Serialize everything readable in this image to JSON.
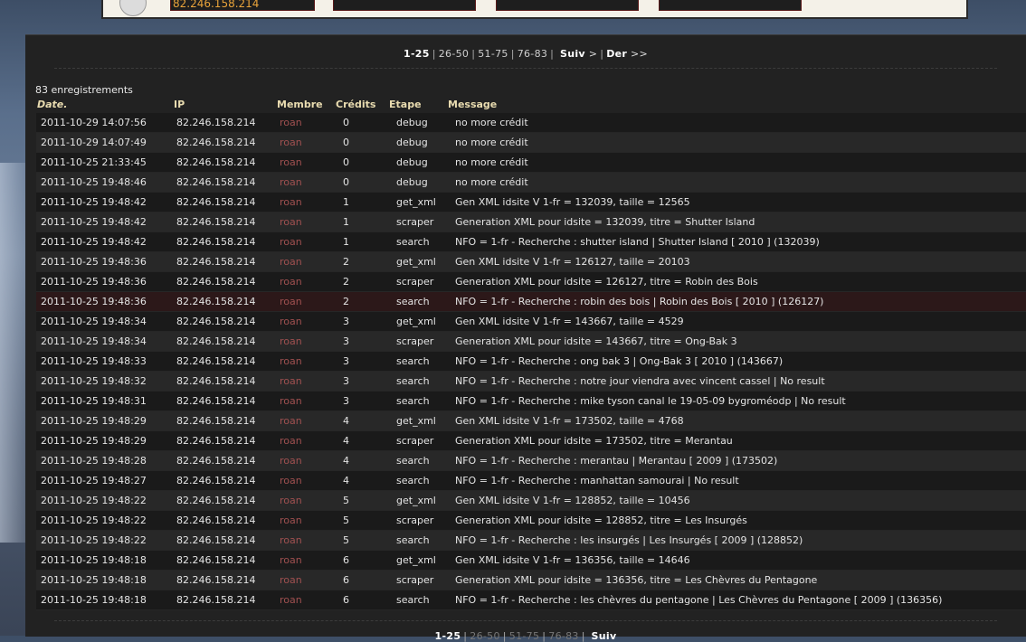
{
  "top_panel": {
    "ip_value": "82.246.158.214"
  },
  "pager": {
    "current": "1-25",
    "pages": [
      "26-50",
      "51-75",
      "76-83"
    ],
    "next_label": "Suiv",
    "next_arrow": ">",
    "last_label": "Der",
    "last_arrow": ">>"
  },
  "record_count": "83 enregistrements",
  "columns": {
    "date": "Date.",
    "ip": "IP",
    "member": "Membre",
    "credits": "Crédits",
    "step": "Etape",
    "message": "Message"
  },
  "rows": [
    {
      "date": "2011-10-29 14:07:56",
      "ip": "82.246.158.214",
      "member": "roan",
      "credits": "0",
      "step": "debug",
      "message": "no more crédit"
    },
    {
      "date": "2011-10-29 14:07:49",
      "ip": "82.246.158.214",
      "member": "roan",
      "credits": "0",
      "step": "debug",
      "message": "no more crédit"
    },
    {
      "date": "2011-10-25 21:33:45",
      "ip": "82.246.158.214",
      "member": "roan",
      "credits": "0",
      "step": "debug",
      "message": "no more crédit"
    },
    {
      "date": "2011-10-25 19:48:46",
      "ip": "82.246.158.214",
      "member": "roan",
      "credits": "0",
      "step": "debug",
      "message": "no more crédit"
    },
    {
      "date": "2011-10-25 19:48:42",
      "ip": "82.246.158.214",
      "member": "roan",
      "credits": "1",
      "step": "get_xml",
      "message": "Gen XML idsite V 1-fr = 132039, taille = 12565"
    },
    {
      "date": "2011-10-25 19:48:42",
      "ip": "82.246.158.214",
      "member": "roan",
      "credits": "1",
      "step": "scraper",
      "message": "Generation XML pour idsite = 132039, titre = Shutter Island"
    },
    {
      "date": "2011-10-25 19:48:42",
      "ip": "82.246.158.214",
      "member": "roan",
      "credits": "1",
      "step": "search",
      "message": "NFO = 1-fr - Recherche : shutter island | Shutter Island [ 2010 ] (132039)"
    },
    {
      "date": "2011-10-25 19:48:36",
      "ip": "82.246.158.214",
      "member": "roan",
      "credits": "2",
      "step": "get_xml",
      "message": "Gen XML idsite V 1-fr = 126127, taille = 20103"
    },
    {
      "date": "2011-10-25 19:48:36",
      "ip": "82.246.158.214",
      "member": "roan",
      "credits": "2",
      "step": "scraper",
      "message": "Generation XML pour idsite = 126127, titre = Robin des Bois"
    },
    {
      "date": "2011-10-25 19:48:36",
      "ip": "82.246.158.214",
      "member": "roan",
      "credits": "2",
      "step": "search",
      "message": "NFO = 1-fr - Recherche : robin des bois | Robin des Bois [ 2010 ] (126127)"
    },
    {
      "date": "2011-10-25 19:48:34",
      "ip": "82.246.158.214",
      "member": "roan",
      "credits": "3",
      "step": "get_xml",
      "message": "Gen XML idsite V 1-fr = 143667, taille = 4529"
    },
    {
      "date": "2011-10-25 19:48:34",
      "ip": "82.246.158.214",
      "member": "roan",
      "credits": "3",
      "step": "scraper",
      "message": "Generation XML pour idsite = 143667, titre = Ong-Bak 3"
    },
    {
      "date": "2011-10-25 19:48:33",
      "ip": "82.246.158.214",
      "member": "roan",
      "credits": "3",
      "step": "search",
      "message": "NFO = 1-fr - Recherche : ong bak 3 | Ong-Bak 3 [ 2010 ] (143667)"
    },
    {
      "date": "2011-10-25 19:48:32",
      "ip": "82.246.158.214",
      "member": "roan",
      "credits": "3",
      "step": "search",
      "message": "NFO = 1-fr - Recherche : notre jour viendra avec vincent cassel | No result"
    },
    {
      "date": "2011-10-25 19:48:31",
      "ip": "82.246.158.214",
      "member": "roan",
      "credits": "3",
      "step": "search",
      "message": "NFO = 1-fr - Recherche : mike tyson canal le 19-05-09 bygroméodp | No result"
    },
    {
      "date": "2011-10-25 19:48:29",
      "ip": "82.246.158.214",
      "member": "roan",
      "credits": "4",
      "step": "get_xml",
      "message": "Gen XML idsite V 1-fr = 173502, taille = 4768"
    },
    {
      "date": "2011-10-25 19:48:29",
      "ip": "82.246.158.214",
      "member": "roan",
      "credits": "4",
      "step": "scraper",
      "message": "Generation XML pour idsite = 173502, titre = Merantau"
    },
    {
      "date": "2011-10-25 19:48:28",
      "ip": "82.246.158.214",
      "member": "roan",
      "credits": "4",
      "step": "search",
      "message": "NFO = 1-fr - Recherche : merantau | Merantau [ 2009 ] (173502)"
    },
    {
      "date": "2011-10-25 19:48:27",
      "ip": "82.246.158.214",
      "member": "roan",
      "credits": "4",
      "step": "search",
      "message": "NFO = 1-fr - Recherche : manhattan samourai | No result"
    },
    {
      "date": "2011-10-25 19:48:22",
      "ip": "82.246.158.214",
      "member": "roan",
      "credits": "5",
      "step": "get_xml",
      "message": "Gen XML idsite V 1-fr = 128852, taille = 10456"
    },
    {
      "date": "2011-10-25 19:48:22",
      "ip": "82.246.158.214",
      "member": "roan",
      "credits": "5",
      "step": "scraper",
      "message": "Generation XML pour idsite = 128852, titre = Les Insurgés"
    },
    {
      "date": "2011-10-25 19:48:22",
      "ip": "82.246.158.214",
      "member": "roan",
      "credits": "5",
      "step": "search",
      "message": "NFO = 1-fr - Recherche : les insurgés | Les Insurgés [ 2009 ] (128852)"
    },
    {
      "date": "2011-10-25 19:48:18",
      "ip": "82.246.158.214",
      "member": "roan",
      "credits": "6",
      "step": "get_xml",
      "message": "Gen XML idsite V 1-fr = 136356, taille = 14646"
    },
    {
      "date": "2011-10-25 19:48:18",
      "ip": "82.246.158.214",
      "member": "roan",
      "credits": "6",
      "step": "scraper",
      "message": "Generation XML pour idsite = 136356, titre = Les Chèvres du Pentagone"
    },
    {
      "date": "2011-10-25 19:48:18",
      "ip": "82.246.158.214",
      "member": "roan",
      "credits": "6",
      "step": "search",
      "message": "NFO = 1-fr - Recherche : les chèvres du pentagone | Les Chèvres du Pentagone [ 2009 ] (136356)"
    }
  ],
  "highlighted_row": 9,
  "colors": {
    "member_text": "#a05050",
    "header_text": "#e9dcb0",
    "highlight_row": "#2c1819",
    "ip_text": "#e8a33a"
  }
}
